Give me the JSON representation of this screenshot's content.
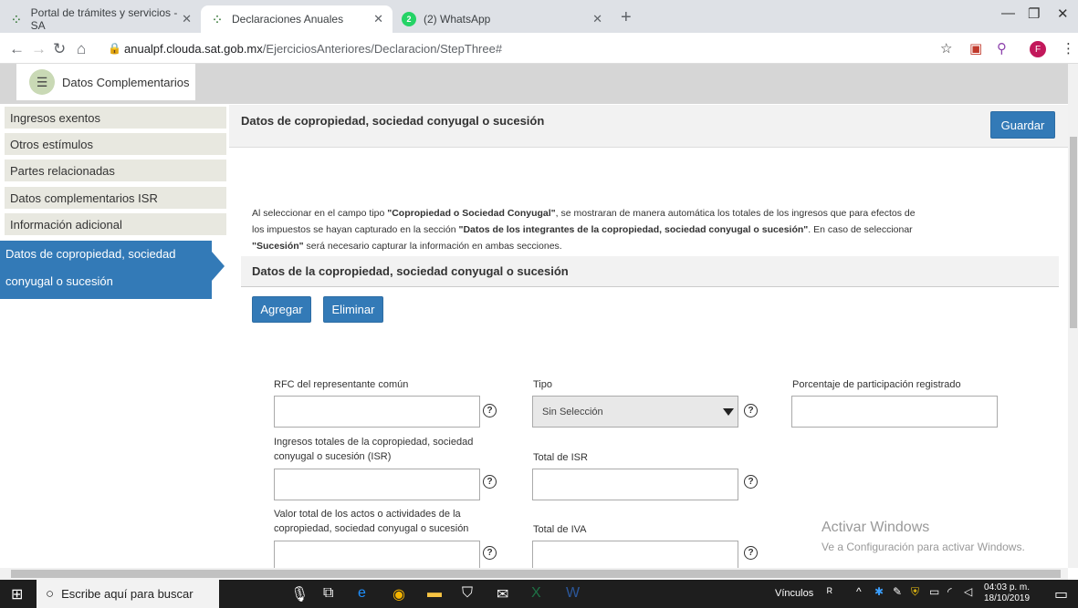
{
  "browser": {
    "tabs": [
      {
        "label": "Portal de trámites y servicios - SA",
        "icon": "sat-icon"
      },
      {
        "label": "Declaraciones Anuales",
        "icon": "sat-icon"
      },
      {
        "label": "(2) WhatsApp",
        "icon": "whatsapp-icon",
        "badge": "2"
      }
    ],
    "url_host": "anualpf.clouda.sat.gob.mx",
    "url_path": "/EjerciciosAnteriores/Declaracion/StepThree#",
    "profile_initial": "F"
  },
  "section_tab": {
    "label": "Datos Complementarios"
  },
  "sidebar": {
    "items": [
      {
        "label": "Ingresos exentos"
      },
      {
        "label": "Otros estímulos"
      },
      {
        "label": "Partes relacionadas"
      },
      {
        "label": "Datos complementarios ISR"
      },
      {
        "label": "Información adicional"
      }
    ],
    "active_line1": "Datos de copropiedad, sociedad",
    "active_line2": "conyugal o sucesión"
  },
  "header": {
    "title": "Datos de copropiedad, sociedad conyugal o sucesión",
    "save_label": "Guardar"
  },
  "info": {
    "p1": "Al seleccionar en el campo tipo ",
    "b1": "\"Copropiedad o Sociedad Conyugal\"",
    "p2": ", se mostraran de manera automática los totales de los ingresos que para efectos de",
    "p3": "los impuestos se hayan capturado en la sección ",
    "b2": "\"Datos de los integrantes de la copropiedad, sociedad conyugal o sucesión\"",
    "p4": ". En caso de seleccionar",
    "b3": "\"Sucesión\"",
    "p5": " será necesario capturar la información en ambas secciones."
  },
  "section2": {
    "title": "Datos de la copropiedad, sociedad conyugal o sucesión",
    "add_label": "Agregar",
    "delete_label": "Eliminar"
  },
  "form": {
    "rfc_label": "RFC del representante común",
    "tipo_label": "Tipo",
    "tipo_value": "Sin Selección",
    "porcentaje_label": "Porcentaje de participación registrado",
    "ingresos_label_1": "Ingresos totales de la copropiedad, sociedad",
    "ingresos_label_2": "conyugal o sucesión (ISR)",
    "total_isr_label": "Total de ISR",
    "valor_label_1": "Valor total de los actos o actividades de la",
    "valor_label_2": "copropiedad, sociedad conyugal o sucesión",
    "total_iva_label": "Total de IVA"
  },
  "watermark": {
    "line1": "Activar Windows",
    "line2": "Ve a Configuración para activar Windows."
  },
  "taskbar": {
    "search_placeholder": "Escribe aquí para buscar",
    "links_label": "Vínculos",
    "time": "04:03 p. m.",
    "date": "18/10/2019"
  }
}
